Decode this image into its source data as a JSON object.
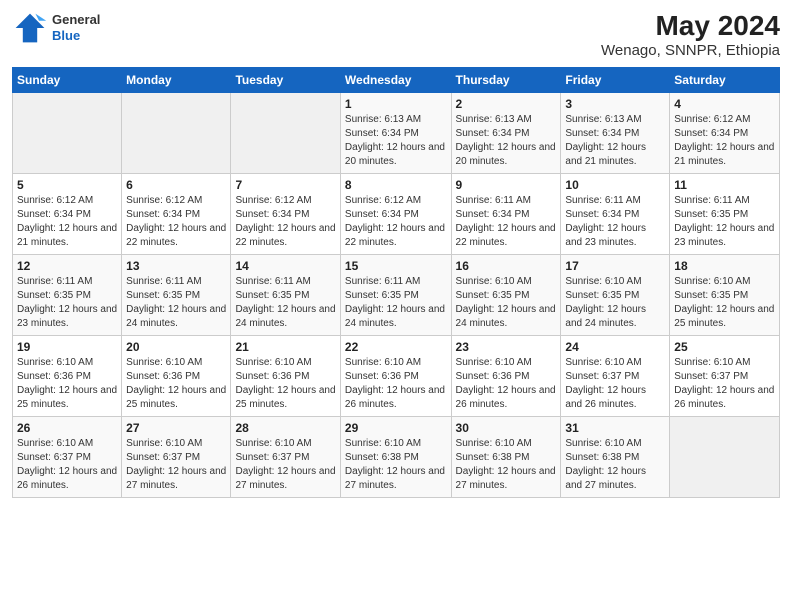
{
  "header": {
    "logo": {
      "general": "General",
      "blue": "Blue"
    },
    "title": "May 2024",
    "location": "Wenago, SNNPR, Ethiopia"
  },
  "weekdays": [
    "Sunday",
    "Monday",
    "Tuesday",
    "Wednesday",
    "Thursday",
    "Friday",
    "Saturday"
  ],
  "weeks": [
    [
      {
        "day": "",
        "sunrise": "",
        "sunset": "",
        "daylight": ""
      },
      {
        "day": "",
        "sunrise": "",
        "sunset": "",
        "daylight": ""
      },
      {
        "day": "",
        "sunrise": "",
        "sunset": "",
        "daylight": ""
      },
      {
        "day": "1",
        "sunrise": "Sunrise: 6:13 AM",
        "sunset": "Sunset: 6:34 PM",
        "daylight": "Daylight: 12 hours and 20 minutes."
      },
      {
        "day": "2",
        "sunrise": "Sunrise: 6:13 AM",
        "sunset": "Sunset: 6:34 PM",
        "daylight": "Daylight: 12 hours and 20 minutes."
      },
      {
        "day": "3",
        "sunrise": "Sunrise: 6:13 AM",
        "sunset": "Sunset: 6:34 PM",
        "daylight": "Daylight: 12 hours and 21 minutes."
      },
      {
        "day": "4",
        "sunrise": "Sunrise: 6:12 AM",
        "sunset": "Sunset: 6:34 PM",
        "daylight": "Daylight: 12 hours and 21 minutes."
      }
    ],
    [
      {
        "day": "5",
        "sunrise": "Sunrise: 6:12 AM",
        "sunset": "Sunset: 6:34 PM",
        "daylight": "Daylight: 12 hours and 21 minutes."
      },
      {
        "day": "6",
        "sunrise": "Sunrise: 6:12 AM",
        "sunset": "Sunset: 6:34 PM",
        "daylight": "Daylight: 12 hours and 22 minutes."
      },
      {
        "day": "7",
        "sunrise": "Sunrise: 6:12 AM",
        "sunset": "Sunset: 6:34 PM",
        "daylight": "Daylight: 12 hours and 22 minutes."
      },
      {
        "day": "8",
        "sunrise": "Sunrise: 6:12 AM",
        "sunset": "Sunset: 6:34 PM",
        "daylight": "Daylight: 12 hours and 22 minutes."
      },
      {
        "day": "9",
        "sunrise": "Sunrise: 6:11 AM",
        "sunset": "Sunset: 6:34 PM",
        "daylight": "Daylight: 12 hours and 22 minutes."
      },
      {
        "day": "10",
        "sunrise": "Sunrise: 6:11 AM",
        "sunset": "Sunset: 6:34 PM",
        "daylight": "Daylight: 12 hours and 23 minutes."
      },
      {
        "day": "11",
        "sunrise": "Sunrise: 6:11 AM",
        "sunset": "Sunset: 6:35 PM",
        "daylight": "Daylight: 12 hours and 23 minutes."
      }
    ],
    [
      {
        "day": "12",
        "sunrise": "Sunrise: 6:11 AM",
        "sunset": "Sunset: 6:35 PM",
        "daylight": "Daylight: 12 hours and 23 minutes."
      },
      {
        "day": "13",
        "sunrise": "Sunrise: 6:11 AM",
        "sunset": "Sunset: 6:35 PM",
        "daylight": "Daylight: 12 hours and 24 minutes."
      },
      {
        "day": "14",
        "sunrise": "Sunrise: 6:11 AM",
        "sunset": "Sunset: 6:35 PM",
        "daylight": "Daylight: 12 hours and 24 minutes."
      },
      {
        "day": "15",
        "sunrise": "Sunrise: 6:11 AM",
        "sunset": "Sunset: 6:35 PM",
        "daylight": "Daylight: 12 hours and 24 minutes."
      },
      {
        "day": "16",
        "sunrise": "Sunrise: 6:10 AM",
        "sunset": "Sunset: 6:35 PM",
        "daylight": "Daylight: 12 hours and 24 minutes."
      },
      {
        "day": "17",
        "sunrise": "Sunrise: 6:10 AM",
        "sunset": "Sunset: 6:35 PM",
        "daylight": "Daylight: 12 hours and 24 minutes."
      },
      {
        "day": "18",
        "sunrise": "Sunrise: 6:10 AM",
        "sunset": "Sunset: 6:35 PM",
        "daylight": "Daylight: 12 hours and 25 minutes."
      }
    ],
    [
      {
        "day": "19",
        "sunrise": "Sunrise: 6:10 AM",
        "sunset": "Sunset: 6:36 PM",
        "daylight": "Daylight: 12 hours and 25 minutes."
      },
      {
        "day": "20",
        "sunrise": "Sunrise: 6:10 AM",
        "sunset": "Sunset: 6:36 PM",
        "daylight": "Daylight: 12 hours and 25 minutes."
      },
      {
        "day": "21",
        "sunrise": "Sunrise: 6:10 AM",
        "sunset": "Sunset: 6:36 PM",
        "daylight": "Daylight: 12 hours and 25 minutes."
      },
      {
        "day": "22",
        "sunrise": "Sunrise: 6:10 AM",
        "sunset": "Sunset: 6:36 PM",
        "daylight": "Daylight: 12 hours and 26 minutes."
      },
      {
        "day": "23",
        "sunrise": "Sunrise: 6:10 AM",
        "sunset": "Sunset: 6:36 PM",
        "daylight": "Daylight: 12 hours and 26 minutes."
      },
      {
        "day": "24",
        "sunrise": "Sunrise: 6:10 AM",
        "sunset": "Sunset: 6:37 PM",
        "daylight": "Daylight: 12 hours and 26 minutes."
      },
      {
        "day": "25",
        "sunrise": "Sunrise: 6:10 AM",
        "sunset": "Sunset: 6:37 PM",
        "daylight": "Daylight: 12 hours and 26 minutes."
      }
    ],
    [
      {
        "day": "26",
        "sunrise": "Sunrise: 6:10 AM",
        "sunset": "Sunset: 6:37 PM",
        "daylight": "Daylight: 12 hours and 26 minutes."
      },
      {
        "day": "27",
        "sunrise": "Sunrise: 6:10 AM",
        "sunset": "Sunset: 6:37 PM",
        "daylight": "Daylight: 12 hours and 27 minutes."
      },
      {
        "day": "28",
        "sunrise": "Sunrise: 6:10 AM",
        "sunset": "Sunset: 6:37 PM",
        "daylight": "Daylight: 12 hours and 27 minutes."
      },
      {
        "day": "29",
        "sunrise": "Sunrise: 6:10 AM",
        "sunset": "Sunset: 6:38 PM",
        "daylight": "Daylight: 12 hours and 27 minutes."
      },
      {
        "day": "30",
        "sunrise": "Sunrise: 6:10 AM",
        "sunset": "Sunset: 6:38 PM",
        "daylight": "Daylight: 12 hours and 27 minutes."
      },
      {
        "day": "31",
        "sunrise": "Sunrise: 6:10 AM",
        "sunset": "Sunset: 6:38 PM",
        "daylight": "Daylight: 12 hours and 27 minutes."
      },
      {
        "day": "",
        "sunrise": "",
        "sunset": "",
        "daylight": ""
      }
    ]
  ]
}
